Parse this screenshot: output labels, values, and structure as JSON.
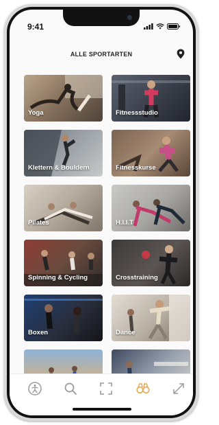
{
  "status": {
    "time": "9:41"
  },
  "header": {
    "title": "ALLE SPORTARTEN",
    "location_icon": "location-pin-icon"
  },
  "sports": [
    {
      "label": "Yoga"
    },
    {
      "label": "Fitnessstudio"
    },
    {
      "label": "Klettern & Bouldern"
    },
    {
      "label": "Fitnesskurse"
    },
    {
      "label": "Pilates"
    },
    {
      "label": "H.I.I.T"
    },
    {
      "label": "Spinning & Cycling"
    },
    {
      "label": "Crosstraining"
    },
    {
      "label": "Boxen"
    },
    {
      "label": "Dance"
    },
    {
      "label": ""
    },
    {
      "label": ""
    }
  ],
  "tabbar": {
    "tabs": [
      {
        "icon": "activity-icon"
      },
      {
        "icon": "search-icon"
      },
      {
        "icon": "scan-icon"
      },
      {
        "icon": "binoculars-icon",
        "active": true
      },
      {
        "icon": "resize-icon"
      }
    ],
    "active_color": "#e3a94f",
    "inactive_color": "#9a9a9a"
  }
}
